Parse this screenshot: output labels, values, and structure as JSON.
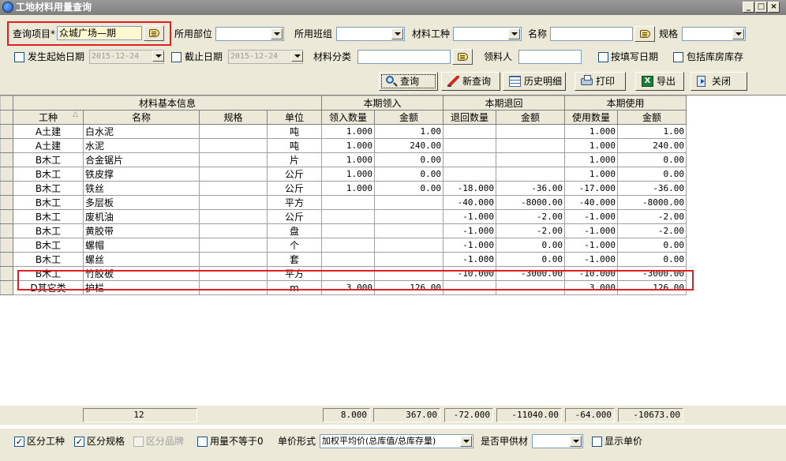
{
  "window": {
    "title": "工地材料用量查询"
  },
  "filters": {
    "project_label": "查询项目*",
    "project_value": "众城广场—期",
    "dept_label": "所用部位",
    "team_label": "所用班组",
    "material_type_label": "材料工种",
    "name_label": "名称",
    "spec_label": "规格",
    "start_date_label": "发生起始日期",
    "start_date_value": "2015-12-24",
    "end_date_label": "截止日期",
    "end_date_value": "2015-12-24",
    "category_label": "材料分类",
    "receiver_label": "领料人",
    "by_entry_date_label": "按填写日期",
    "include_warehouse_label": "包括库房库存"
  },
  "toolbar": {
    "query": "查询",
    "new_query": "新查询",
    "history": "历史明细",
    "print": "打印",
    "export": "导出",
    "close": "关闭",
    "export_icon_glyph": "X"
  },
  "table": {
    "groups": [
      "材料基本信息",
      "本期领入",
      "本期退回",
      "本期使用"
    ],
    "columns": [
      "工种",
      "名称",
      "规格",
      "单位",
      "领入数量",
      "金额",
      "退回数量",
      "金额",
      "使用数量",
      "金额"
    ],
    "sort_marker": "△",
    "rows": [
      [
        "A土建",
        "白水泥",
        "",
        "吨",
        "1.000",
        "1.00",
        "",
        "",
        "1.000",
        "1.00"
      ],
      [
        "A土建",
        "水泥",
        "",
        "吨",
        "1.000",
        "240.00",
        "",
        "",
        "1.000",
        "240.00"
      ],
      [
        "B木工",
        "合金锯片",
        "",
        "片",
        "1.000",
        "0.00",
        "",
        "",
        "1.000",
        "0.00"
      ],
      [
        "B木工",
        "铁皮撑",
        "",
        "公斤",
        "1.000",
        "0.00",
        "",
        "",
        "1.000",
        "0.00"
      ],
      [
        "B木工",
        "铁丝",
        "",
        "公斤",
        "1.000",
        "0.00",
        "-18.000",
        "-36.00",
        "-17.000",
        "-36.00"
      ],
      [
        "B木工",
        "多层板",
        "",
        "平方",
        "",
        "",
        "-40.000",
        "-8000.00",
        "-40.000",
        "-8000.00"
      ],
      [
        "B木工",
        "废机油",
        "",
        "公斤",
        "",
        "",
        "-1.000",
        "-2.00",
        "-1.000",
        "-2.00"
      ],
      [
        "B木工",
        "黄胶带",
        "",
        "盘",
        "",
        "",
        "-1.000",
        "-2.00",
        "-1.000",
        "-2.00"
      ],
      [
        "B木工",
        "螺帽",
        "",
        "个",
        "",
        "",
        "-1.000",
        "0.00",
        "-1.000",
        "0.00"
      ],
      [
        "B木工",
        "螺丝",
        "",
        "套",
        "",
        "",
        "-1.000",
        "0.00",
        "-1.000",
        "0.00"
      ],
      [
        "B木工",
        "竹胶板",
        "",
        "平方",
        "",
        "",
        "-10.000",
        "-3000.00",
        "-10.000",
        "-3000.00"
      ],
      [
        "D其它类",
        "护栏",
        "",
        "m",
        "3.000",
        "126.00",
        "",
        "",
        "3.000",
        "126.00"
      ]
    ]
  },
  "totals": {
    "count": "12",
    "in_qty": "8.000",
    "in_amount": "367.00",
    "ret_qty": "-72.000",
    "ret_amount": "-11040.00",
    "use_qty": "-64.000",
    "use_amount": "-10673.00"
  },
  "options": {
    "by_type_label": "区分工种",
    "by_spec_label": "区分规格",
    "by_brand_label": "区分品牌",
    "qty_neq_label": "用量不等于0",
    "price_mode_label": "单价形式",
    "price_mode_value": "加权平均价(总库值/总库存量)",
    "owner_supplied_label": "是否甲供材",
    "show_price_label": "显示单价",
    "check_mark": "✓"
  },
  "colors": {
    "highlight_box": "#e02020",
    "title_bar": "#8c8c8c"
  }
}
